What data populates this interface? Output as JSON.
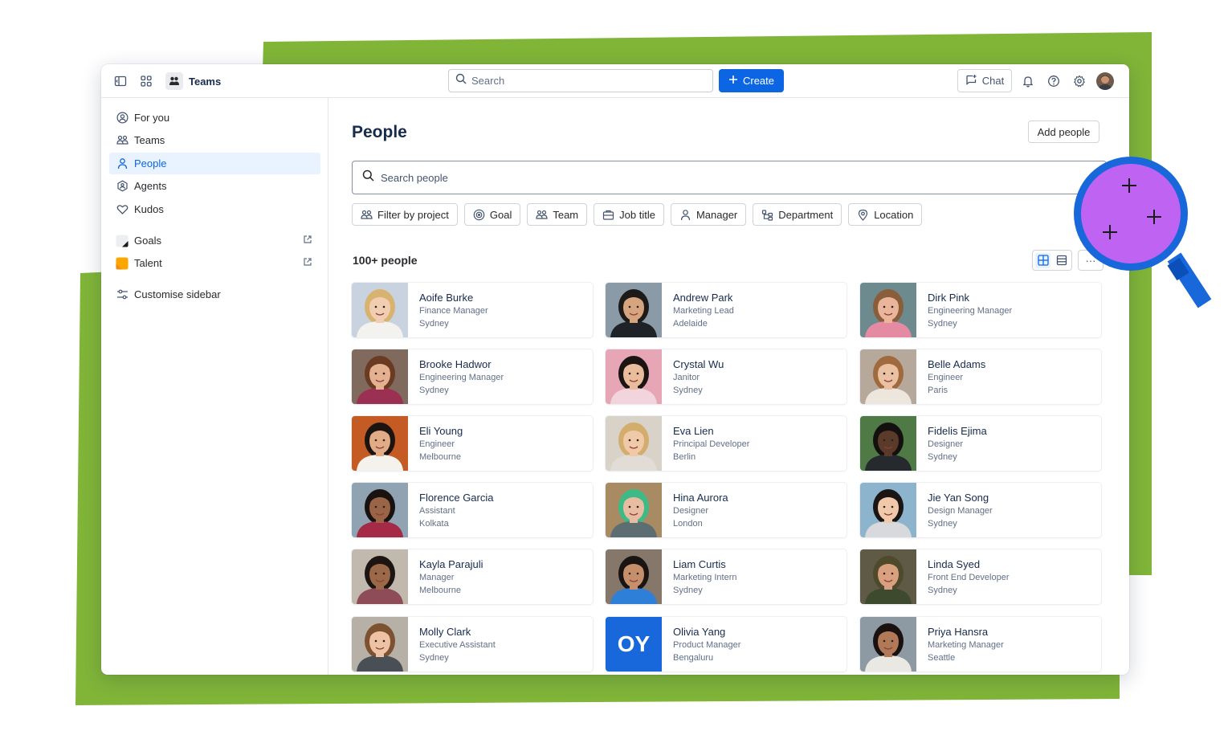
{
  "colors": {
    "green": "#80b538",
    "brand_blue": "#0c66e4",
    "magnifier_purple": "#bf63f3",
    "magnifier_blue": "#1868db"
  },
  "topbar": {
    "app_name": "Teams",
    "search_placeholder": "Search",
    "create_label": "Create",
    "chat_label": "Chat",
    "icons": [
      "sidebar-toggle-icon",
      "app-switcher-icon",
      "notifications-icon",
      "help-icon",
      "settings-icon"
    ]
  },
  "sidebar": {
    "items": [
      {
        "label": "For you",
        "icon": "person-circle-icon"
      },
      {
        "label": "Teams",
        "icon": "teams-icon"
      },
      {
        "label": "People",
        "icon": "person-icon",
        "active": true
      },
      {
        "label": "Agents",
        "icon": "agent-icon"
      },
      {
        "label": "Kudos",
        "icon": "heart-icon"
      }
    ],
    "apps": [
      {
        "label": "Goals",
        "icon": "goals-app-icon"
      },
      {
        "label": "Talent",
        "icon": "talent-app-icon"
      }
    ],
    "customise_label": "Customise sidebar"
  },
  "main": {
    "title": "People",
    "add_people_label": "Add people",
    "search_placeholder": "Search people",
    "filters": [
      {
        "label": "Filter by project",
        "icon": "project-icon"
      },
      {
        "label": "Goal",
        "icon": "goal-icon"
      },
      {
        "label": "Team",
        "icon": "team-icon"
      },
      {
        "label": "Job title",
        "icon": "briefcase-icon"
      },
      {
        "label": "Manager",
        "icon": "manager-icon"
      },
      {
        "label": "Department",
        "icon": "department-icon"
      },
      {
        "label": "Location",
        "icon": "location-icon"
      }
    ],
    "count_label": "100+ people",
    "more_label": "···"
  },
  "people": [
    {
      "name": "Aoife Burke",
      "role": "Finance Manager",
      "location": "Sydney",
      "bg": "#c9d3df",
      "skin": "#f1cdb2",
      "hair": "#d8b370",
      "shirt": "#f4f2ee"
    },
    {
      "name": "Andrew Park",
      "role": "Marketing Lead",
      "location": "Adelaide",
      "bg": "#8a9aa6",
      "skin": "#d6a47e",
      "hair": "#1d1a18",
      "shirt": "#1f2226"
    },
    {
      "name": "Dirk Pink",
      "role": "Engineering Manager",
      "location": "Sydney",
      "bg": "#6d8a8e",
      "skin": "#eab59a",
      "hair": "#8a5d3b",
      "shirt": "#e48aa3"
    },
    {
      "name": "Brooke Hadwor",
      "role": "Engineering Manager",
      "location": "Sydney",
      "bg": "#7f6a5d",
      "skin": "#e3b190",
      "hair": "#6a3b22",
      "shirt": "#9b3052"
    },
    {
      "name": "Crystal Wu",
      "role": "Janitor",
      "location": "Sydney",
      "bg": "#e7a6b6",
      "skin": "#e9bc9c",
      "hair": "#1a1412",
      "shirt": "#f1d4dc"
    },
    {
      "name": "Belle Adams",
      "role": "Engineer",
      "location": "Paris",
      "bg": "#b6a89a",
      "skin": "#eac1a3",
      "hair": "#a06a3f",
      "shirt": "#ece6dd"
    },
    {
      "name": "Eli Young",
      "role": "Engineer",
      "location": "Melbourne",
      "bg": "#c45a24",
      "skin": "#e0ab85",
      "hair": "#1c1410",
      "shirt": "#f5f2ed"
    },
    {
      "name": "Eva Lien",
      "role": "Principal Developer",
      "location": "Berlin",
      "bg": "#d9d2c8",
      "skin": "#f0c9a8",
      "hair": "#d2ad6d",
      "shirt": "#e1ddd6"
    },
    {
      "name": "Fidelis Ejima",
      "role": "Designer",
      "location": "Sydney",
      "bg": "#4f7a45",
      "skin": "#5a3a28",
      "hair": "#141010",
      "shirt": "#26292d"
    },
    {
      "name": "Florence Garcia",
      "role": "Assistant",
      "location": "Kolkata",
      "bg": "#8fa3b3",
      "skin": "#9a6446",
      "hair": "#1a1210",
      "shirt": "#a52a45"
    },
    {
      "name": "Hina Aurora",
      "role": "Designer",
      "location": "London",
      "bg": "#a88a63",
      "skin": "#e8bca0",
      "hair": "#3dba86",
      "shirt": "#5d6e73"
    },
    {
      "name": "Jie Yan Song",
      "role": "Design Manager",
      "location": "Sydney",
      "bg": "#8cb4cc",
      "skin": "#f0c9aa",
      "hair": "#1b1614",
      "shirt": "#d8d9dc"
    },
    {
      "name": "Kayla Parajuli",
      "role": "Manager",
      "location": "Melbourne",
      "bg": "#c1b9ad",
      "skin": "#9b6848",
      "hair": "#1d1512",
      "shirt": "#8e4b58"
    },
    {
      "name": "Liam Curtis",
      "role": "Marketing Intern",
      "location": "Sydney",
      "bg": "#857769",
      "skin": "#c68f6b",
      "hair": "#1a1412",
      "shirt": "#2d7fd8"
    },
    {
      "name": "Linda Syed",
      "role": "Front End Developer",
      "location": "Sydney",
      "bg": "#5f5a45",
      "skin": "#d8a07e",
      "hair": "#4f4a2c",
      "shirt": "#3d4a2e"
    },
    {
      "name": "Molly Clark",
      "role": "Executive Assistant",
      "location": "Sydney",
      "bg": "#b7b0a6",
      "skin": "#eec2a4",
      "hair": "#7d5232",
      "shirt": "#4a4f55"
    },
    {
      "name": "Olivia Yang",
      "role": "Product Manager",
      "location": "Bengaluru",
      "initials": "OY"
    },
    {
      "name": "Priya Hansra",
      "role": "Marketing Manager",
      "location": "Seattle",
      "bg": "#8e9aa3",
      "skin": "#b07a58",
      "hair": "#1a1210",
      "shirt": "#e9e8e3"
    }
  ]
}
